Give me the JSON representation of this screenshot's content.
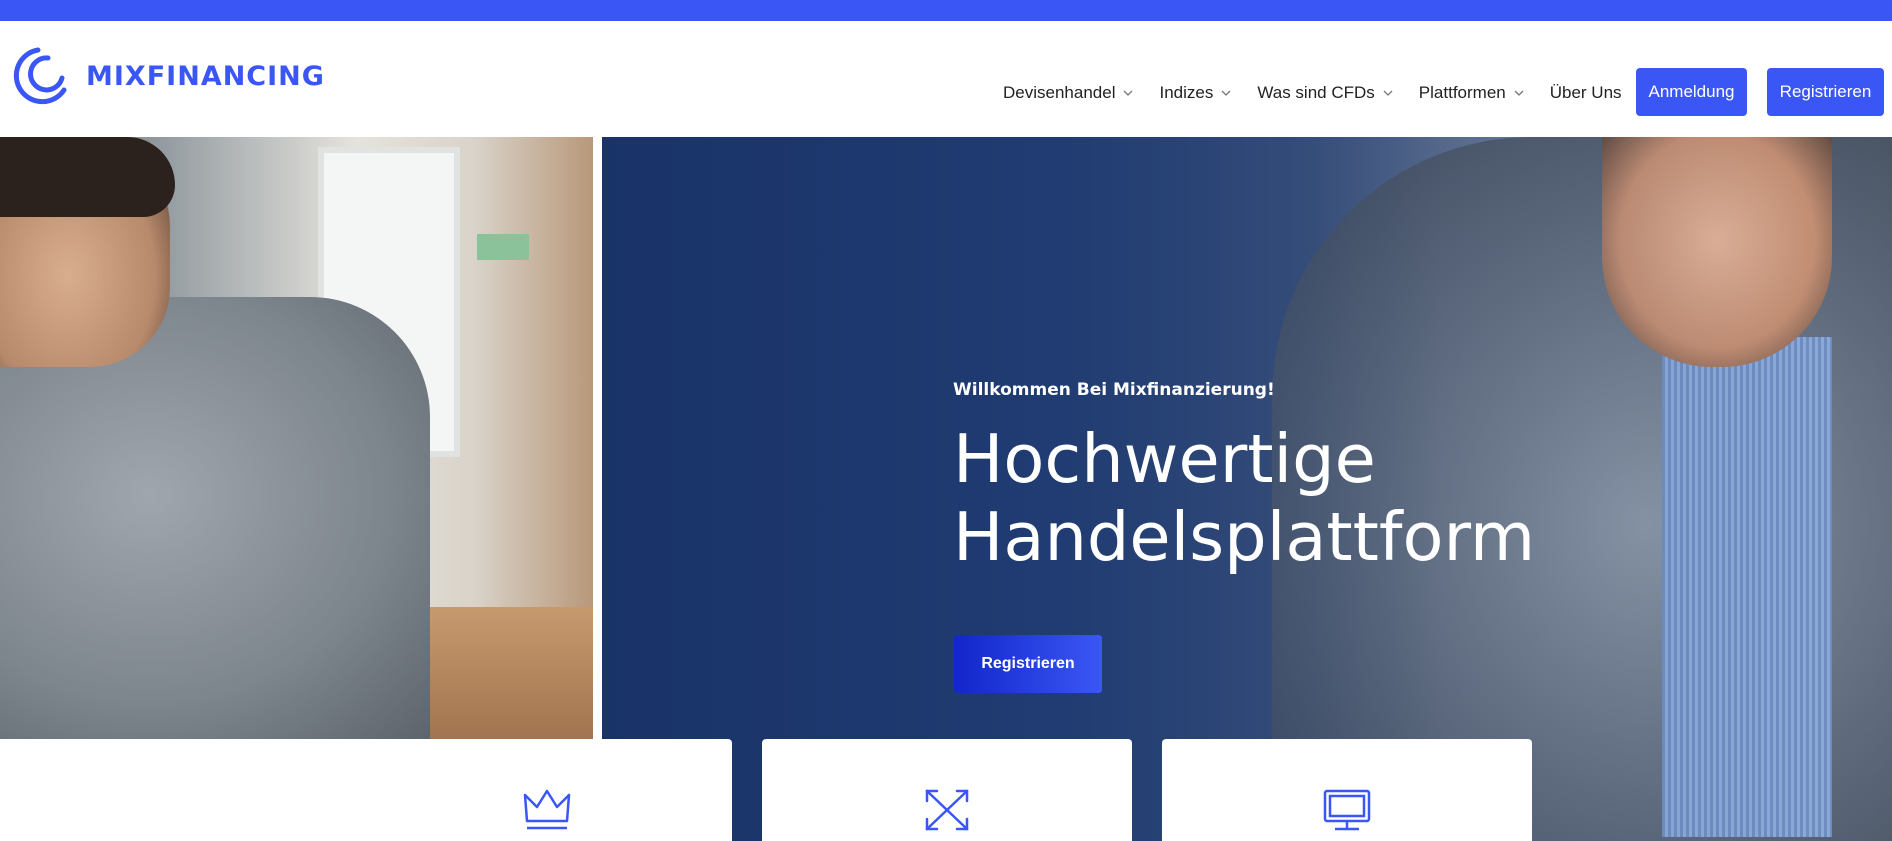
{
  "brand": {
    "name": "MIXFINANCING",
    "accent": "#3a57f5"
  },
  "nav": {
    "items": [
      {
        "label": "Devisenhandel",
        "has_dropdown": true
      },
      {
        "label": "Indizes",
        "has_dropdown": true
      },
      {
        "label": "Was sind CFDs",
        "has_dropdown": true
      },
      {
        "label": "Plattformen",
        "has_dropdown": true
      },
      {
        "label": "Über Uns",
        "has_dropdown": false
      }
    ],
    "login_label": "Anmeldung",
    "register_label": "Registrieren"
  },
  "hero": {
    "kicker": "Willkommen Bei Mixfinanzierung!",
    "title": "Hochwertige Handelsplattform",
    "cta_label": "Registrieren"
  },
  "features": [
    {
      "icon": "crown-icon"
    },
    {
      "icon": "expand-arrows-icon"
    },
    {
      "icon": "monitor-icon"
    }
  ]
}
